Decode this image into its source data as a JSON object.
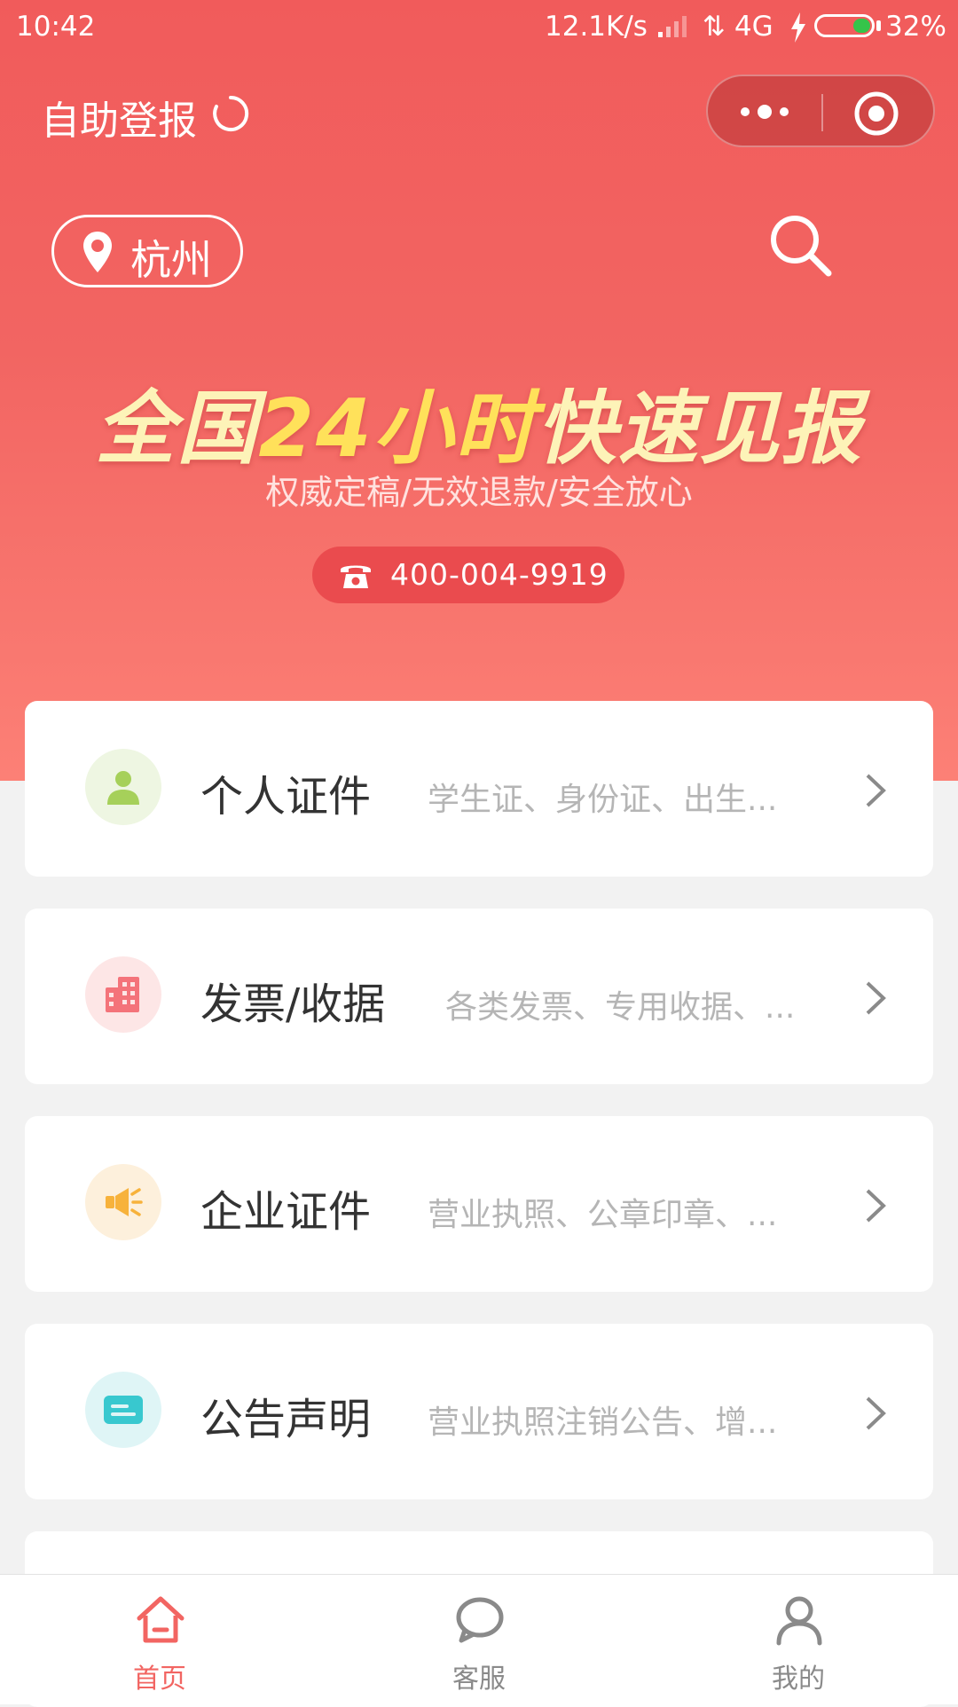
{
  "status_bar": {
    "time": "10:42",
    "network_speed": "12.1K/s",
    "network_type": "4G",
    "battery": "32%",
    "battery_level": 0.32
  },
  "nav": {
    "title": "自助登报"
  },
  "location": {
    "city": "杭州"
  },
  "banner": {
    "headline_a": "全国",
    "headline_b": "24小时",
    "headline_c": "快速见报",
    "subtitle": "权威定稿/无效退款/安全放心",
    "phone": "400-004-9919"
  },
  "categories": [
    {
      "title": "个人证件",
      "desc": "学生证、身份证、出生...",
      "icon": "person-icon",
      "color": "#a6d05a",
      "bg": "#eef6e2"
    },
    {
      "title": "发票/收据",
      "desc": "各类发票、专用收据、...",
      "icon": "building-icon",
      "color": "#f4737a",
      "bg": "#fde6e6"
    },
    {
      "title": "企业证件",
      "desc": "营业执照、公章印章、...",
      "icon": "megaphone-icon",
      "color": "#f7b23b",
      "bg": "#fdf0dc"
    },
    {
      "title": "公告声明",
      "desc": "营业执照注销公告、增...",
      "icon": "card-icon",
      "color": "#38c8cf",
      "bg": "#dff5f6"
    }
  ],
  "tabs": [
    {
      "label": "首页",
      "icon": "home-icon",
      "active": true
    },
    {
      "label": "客服",
      "icon": "chat-icon",
      "active": false
    },
    {
      "label": "我的",
      "icon": "user-icon",
      "active": false
    }
  ],
  "colors": {
    "brand": "#f15b5b",
    "active_tab": "#f26562",
    "inactive_tab": "#8a8a8a"
  }
}
